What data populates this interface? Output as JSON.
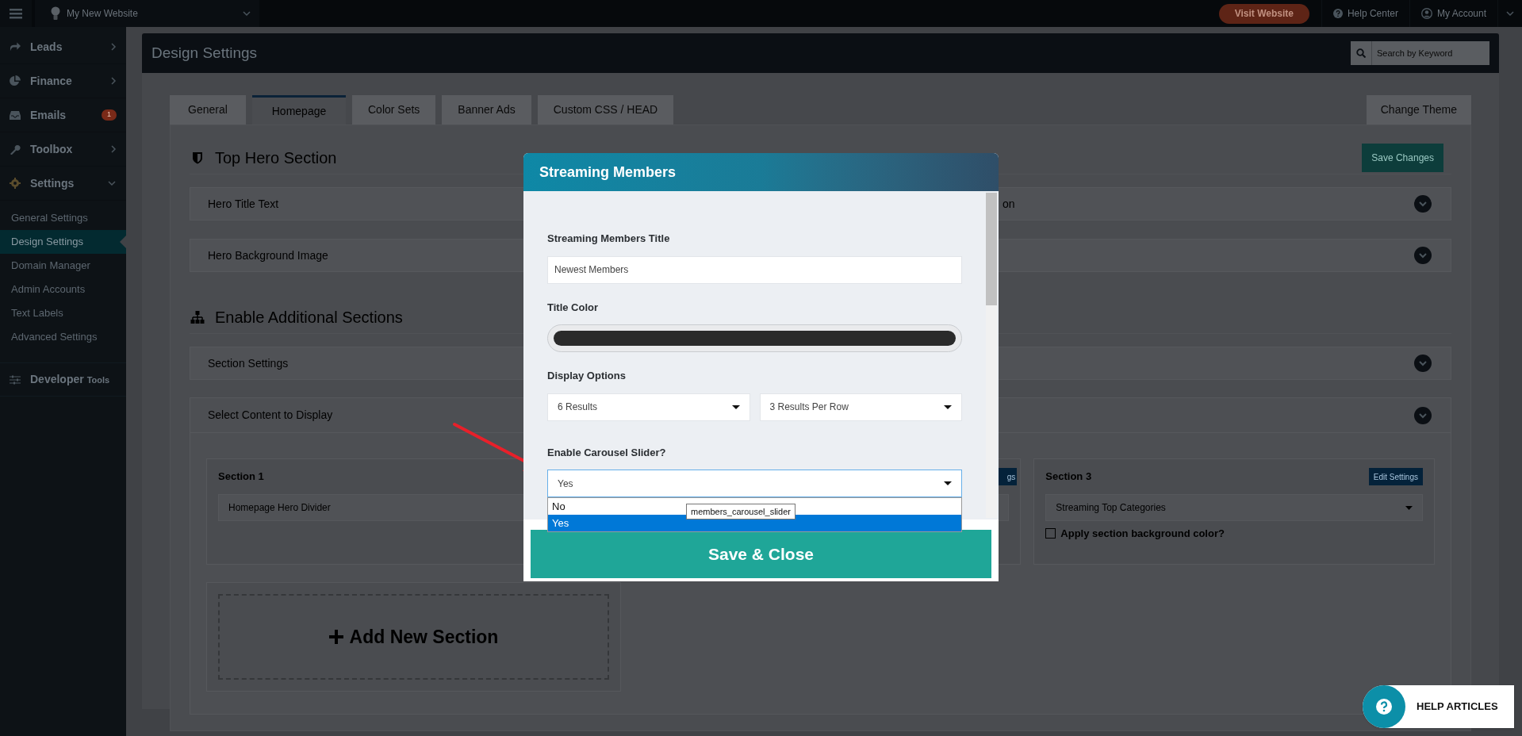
{
  "top_bar": {
    "site_name": "My New Website",
    "visit_button": "Visit Website",
    "help": "Help Center",
    "account": "My Account"
  },
  "sidebar": {
    "items": [
      {
        "kind": "menu",
        "label": "Leads",
        "expanded": false
      },
      {
        "kind": "menu",
        "label": "Finance",
        "expanded": false
      },
      {
        "kind": "badge",
        "label": "Emails",
        "badge": "1"
      },
      {
        "kind": "menu",
        "label": "Toolbox",
        "expanded": false
      },
      {
        "kind": "menu",
        "label": "Settings",
        "expanded": true,
        "children": [
          {
            "label": "General Settings",
            "selected": false
          },
          {
            "label": "Design Settings",
            "selected": true
          },
          {
            "label": "Domain Manager",
            "selected": false
          },
          {
            "label": "Admin Accounts",
            "selected": false
          },
          {
            "label": "Text Labels",
            "selected": false
          },
          {
            "label": "Advanced Settings",
            "selected": false
          }
        ]
      },
      {
        "kind": "plain",
        "label": "Developer",
        "suffix": "Tools"
      }
    ]
  },
  "page": {
    "title": "Design Settings",
    "search": {
      "placeholder": "Search by Keyword"
    },
    "tabs": [
      {
        "label": "General",
        "selected": false
      },
      {
        "label": "Homepage",
        "selected": true
      },
      {
        "label": "Color Sets",
        "selected": false
      },
      {
        "label": "Banner Ads",
        "selected": false
      },
      {
        "label": "Custom CSS / HEAD",
        "selected": false
      }
    ],
    "change_theme": "Change Theme",
    "hero": {
      "heading": "Top Hero Section",
      "save": "Save Changes",
      "rows": [
        {
          "label": "Hero Title Text"
        },
        {
          "label": "on"
        },
        {
          "label": "Hero Background Image"
        },
        {}
      ]
    },
    "additional": {
      "heading": "Enable Additional Sections",
      "settings_row": "Section Settings",
      "content_panel": "Select Content to Display",
      "sections": [
        {
          "title": "Section 1",
          "select": "Homepage Hero Divider"
        },
        {
          "edit": "gs"
        },
        {
          "title": "Section 3",
          "edit": "Edit Settings",
          "select": "Streaming Top Categories",
          "checkbox": {
            "label": "Apply section background color?",
            "checked": false
          }
        }
      ],
      "add_section": "Add New Section"
    }
  },
  "modal": {
    "title": "Streaming Members",
    "fields": [
      {
        "kind": "text",
        "label": "Streaming Members Title",
        "value": "Newest Members"
      },
      {
        "kind": "color",
        "label": "Title Color",
        "color": "#2a2a2a"
      },
      {
        "kind": "selects",
        "label": "Display Options",
        "values": [
          "6 Results",
          "3 Results Per Row"
        ]
      },
      {
        "kind": "dropdown",
        "label": "Enable Carousel Slider?",
        "value": "Yes",
        "options": [
          {
            "label": "No",
            "selected": false
          },
          {
            "label": "Yes",
            "selected": true
          }
        ],
        "tooltip": "members_carousel_slider"
      }
    ],
    "save": "Save & Close"
  },
  "help_button": "HELP ARTICLES"
}
